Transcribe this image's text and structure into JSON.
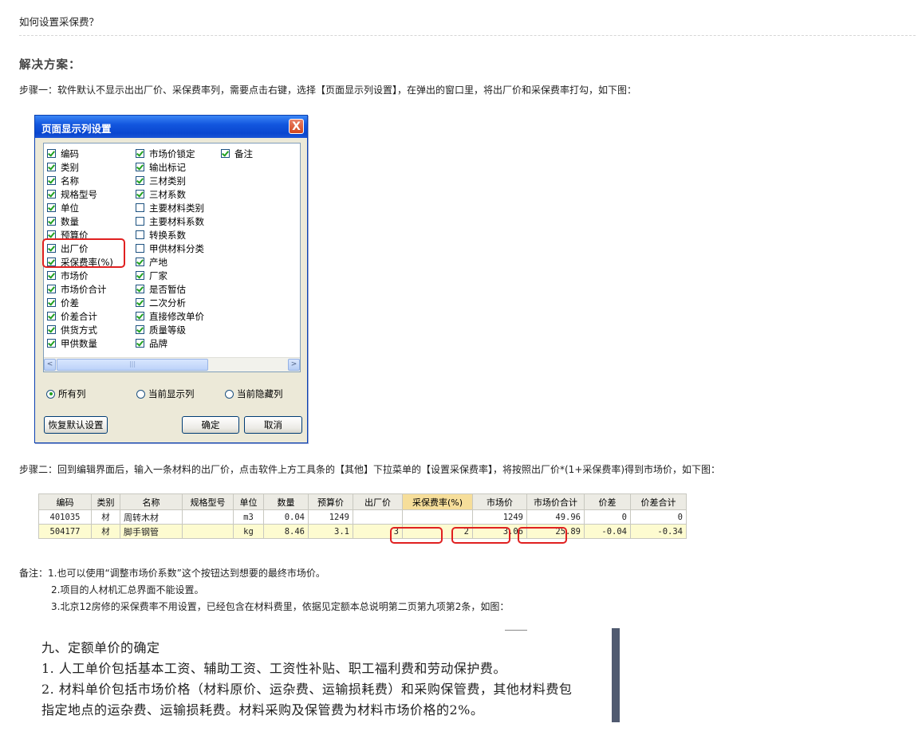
{
  "question": "如何设置采保费？",
  "solution_title": "解决方案：",
  "step1": "步骤一：软件默认不显示出出厂价、采保费率列，需要点击右键，选择【页面显示列设置】，在弹出的窗口里，将出厂价和采保费率打勾，如下图：",
  "dialog": {
    "title": "页面显示列设置",
    "close": "X",
    "col1": [
      {
        "label": "编码",
        "checked": true
      },
      {
        "label": "类别",
        "checked": true
      },
      {
        "label": "名称",
        "checked": true
      },
      {
        "label": "规格型号",
        "checked": true
      },
      {
        "label": "单位",
        "checked": true
      },
      {
        "label": "数量",
        "checked": true
      },
      {
        "label": "预算价",
        "checked": true
      },
      {
        "label": "出厂价",
        "checked": true
      },
      {
        "label": "采保费率(%)",
        "checked": true
      },
      {
        "label": "市场价",
        "checked": true
      },
      {
        "label": "市场价合计",
        "checked": true
      },
      {
        "label": "价差",
        "checked": true
      },
      {
        "label": "价差合计",
        "checked": true
      },
      {
        "label": "供货方式",
        "checked": true
      },
      {
        "label": "甲供数量",
        "checked": true
      }
    ],
    "col2": [
      {
        "label": "市场价锁定",
        "checked": true
      },
      {
        "label": "输出标记",
        "checked": true
      },
      {
        "label": "三材类别",
        "checked": true
      },
      {
        "label": "三材系数",
        "checked": true
      },
      {
        "label": "主要材料类别",
        "checked": false
      },
      {
        "label": "主要材料系数",
        "checked": false
      },
      {
        "label": "转换系数",
        "checked": false
      },
      {
        "label": "甲供材料分类",
        "checked": false
      },
      {
        "label": "产地",
        "checked": true
      },
      {
        "label": "厂家",
        "checked": true
      },
      {
        "label": "是否暂估",
        "checked": true
      },
      {
        "label": "二次分析",
        "checked": true
      },
      {
        "label": "直接修改单价",
        "checked": true
      },
      {
        "label": "质量等级",
        "checked": true
      },
      {
        "label": "品牌",
        "checked": true
      }
    ],
    "col3": [
      {
        "label": "备注",
        "checked": true
      }
    ],
    "scroll_left": "<",
    "scroll_right": ">",
    "scroll_grip": "|||",
    "radio_all": "所有列",
    "radio_shown": "当前显示列",
    "radio_hidden": "当前隐藏列",
    "btn_restore": "恢复默认设置",
    "btn_ok": "确定",
    "btn_cancel": "取消"
  },
  "step2": "步骤二：回到编辑界面后，输入一条材料的出厂价，点击软件上方工具条的【其他】下拉菜单的【设置采保费率】，将按照出厂价*(1+采保费率)得到市场价，如下图：",
  "grid": {
    "headers": [
      "编码",
      "类别",
      "名称",
      "规格型号",
      "单位",
      "数量",
      "预算价",
      "出厂价",
      "采保费率(%)",
      "市场价",
      "市场价合计",
      "价差",
      "价差合计"
    ],
    "rows": [
      [
        "401035",
        "材",
        "周转木材",
        "",
        "m3",
        "0.04",
        "1249",
        "",
        "",
        "1249",
        "49.96",
        "0",
        "0"
      ],
      [
        "504177",
        "材",
        "脚手钢管",
        "",
        "kg",
        "8.46",
        "3.1",
        "3",
        "2",
        "3.06",
        "25.89",
        "-0.04",
        "-0.34"
      ]
    ]
  },
  "notes": {
    "n1": "备注：1.也可以使用“调整市场价系数”这个按钮达到想要的最终市场价。",
    "n2": "2.项目的人材机汇总界面不能设置。",
    "n3": "3.北京12房修的采保费率不用设置，已经包含在材料费里，依据见定额本总说明第二页第九项第2条，如图："
  },
  "quote": {
    "l1": "九、定额单价的确定",
    "l2": "1. 人工单价包括基本工资、辅助工资、工资性补贴、职工福利费和劳动保护费。",
    "l3": "2. 材料单价包括市场价格（材料原价、运杂费、运输损耗费）和采购保管费，其他材料费包",
    "l4": "指定地点的运杂费、运输损耗费。材料采购及保管费为材料市场价格的2%。"
  }
}
